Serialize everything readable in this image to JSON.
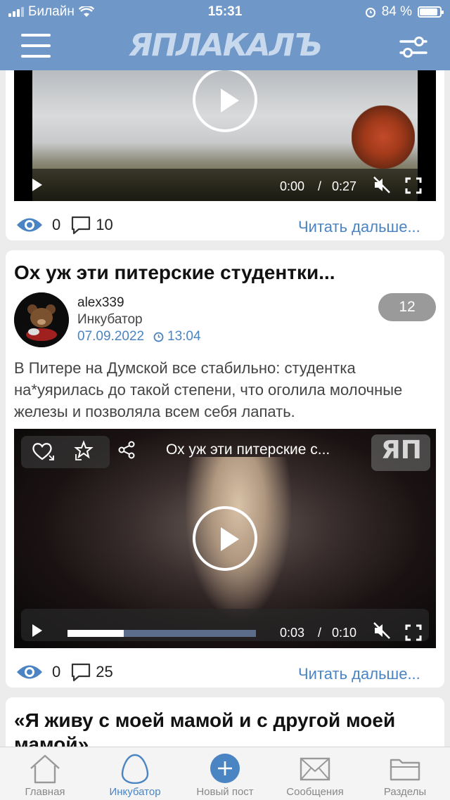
{
  "status_bar": {
    "carrier": "Билайн",
    "time": "15:31",
    "battery": "84 %",
    "battery_level": 0.84
  },
  "header": {
    "logo": "ЯПЛАКАЛЪ"
  },
  "post1": {
    "video": {
      "current": "0:00",
      "separator": "/",
      "duration": "0:27"
    },
    "views": "0",
    "comments": "10",
    "read_more": "Читать дальше..."
  },
  "post2": {
    "title": "Ох уж эти питерские студентки...",
    "author": "alex339",
    "rank": "Инкубатор",
    "date": "07.09.2022",
    "time": "13:04",
    "rating": "12",
    "text": "В Питере на Думской все стабильно: студентка на*уярилась до такой степени, что оголила молочные железы и позволяла всем себя лапать.",
    "video": {
      "overlay_title": "Ох уж эти питерские с...",
      "watermark": "ЯП",
      "current": "0:03",
      "separator": "/",
      "duration": "0:10",
      "progress": 0.3
    },
    "views": "0",
    "comments": "25",
    "read_more": "Читать дальше..."
  },
  "post3": {
    "title": "«Я живу с моей мамой и с другой моей мамой»"
  },
  "tabbar": [
    {
      "label": "Главная",
      "icon": "home-icon"
    },
    {
      "label": "Инкубатор",
      "icon": "egg-icon"
    },
    {
      "label": "Новый пост",
      "icon": "plus-circle-icon"
    },
    {
      "label": "Сообщения",
      "icon": "envelope-icon"
    },
    {
      "label": "Разделы",
      "icon": "folder-icon"
    }
  ]
}
